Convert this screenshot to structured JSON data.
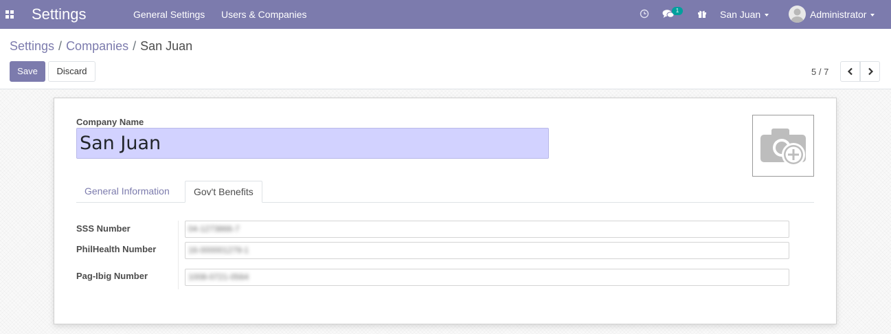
{
  "navbar": {
    "app_title": "Settings",
    "menu": [
      "General Settings",
      "Users & Companies"
    ],
    "message_count": "1",
    "company": "San Juan",
    "user": "Administrator"
  },
  "breadcrumb": {
    "root": "Settings",
    "parent": "Companies",
    "current": "San Juan"
  },
  "actions": {
    "save": "Save",
    "discard": "Discard"
  },
  "pager": {
    "value": "5 / 7"
  },
  "form": {
    "company_name_label": "Company Name",
    "company_name": "San Juan",
    "tabs": [
      "General Information",
      "Gov't Benefits"
    ],
    "active_tab": "Gov't Benefits",
    "fields": [
      {
        "label": "SSS Number",
        "value": "04-1273866-7"
      },
      {
        "label": "PhilHealth Number",
        "value": "16-000001279-1"
      },
      {
        "label": "Pag-Ibig Number",
        "value": "1008-0721-0564"
      }
    ]
  },
  "icons": {
    "apps": "apps-grid-icon",
    "activity": "clock-icon",
    "messages": "chat-icon",
    "gift": "gift-icon",
    "prev": "chevron-left-icon",
    "next": "chevron-right-icon",
    "logo_placeholder": "camera-plus-icon"
  },
  "colors": {
    "brand": "#7c7bad",
    "required_field": "#d2d2ff",
    "badge": "#00a09d"
  }
}
